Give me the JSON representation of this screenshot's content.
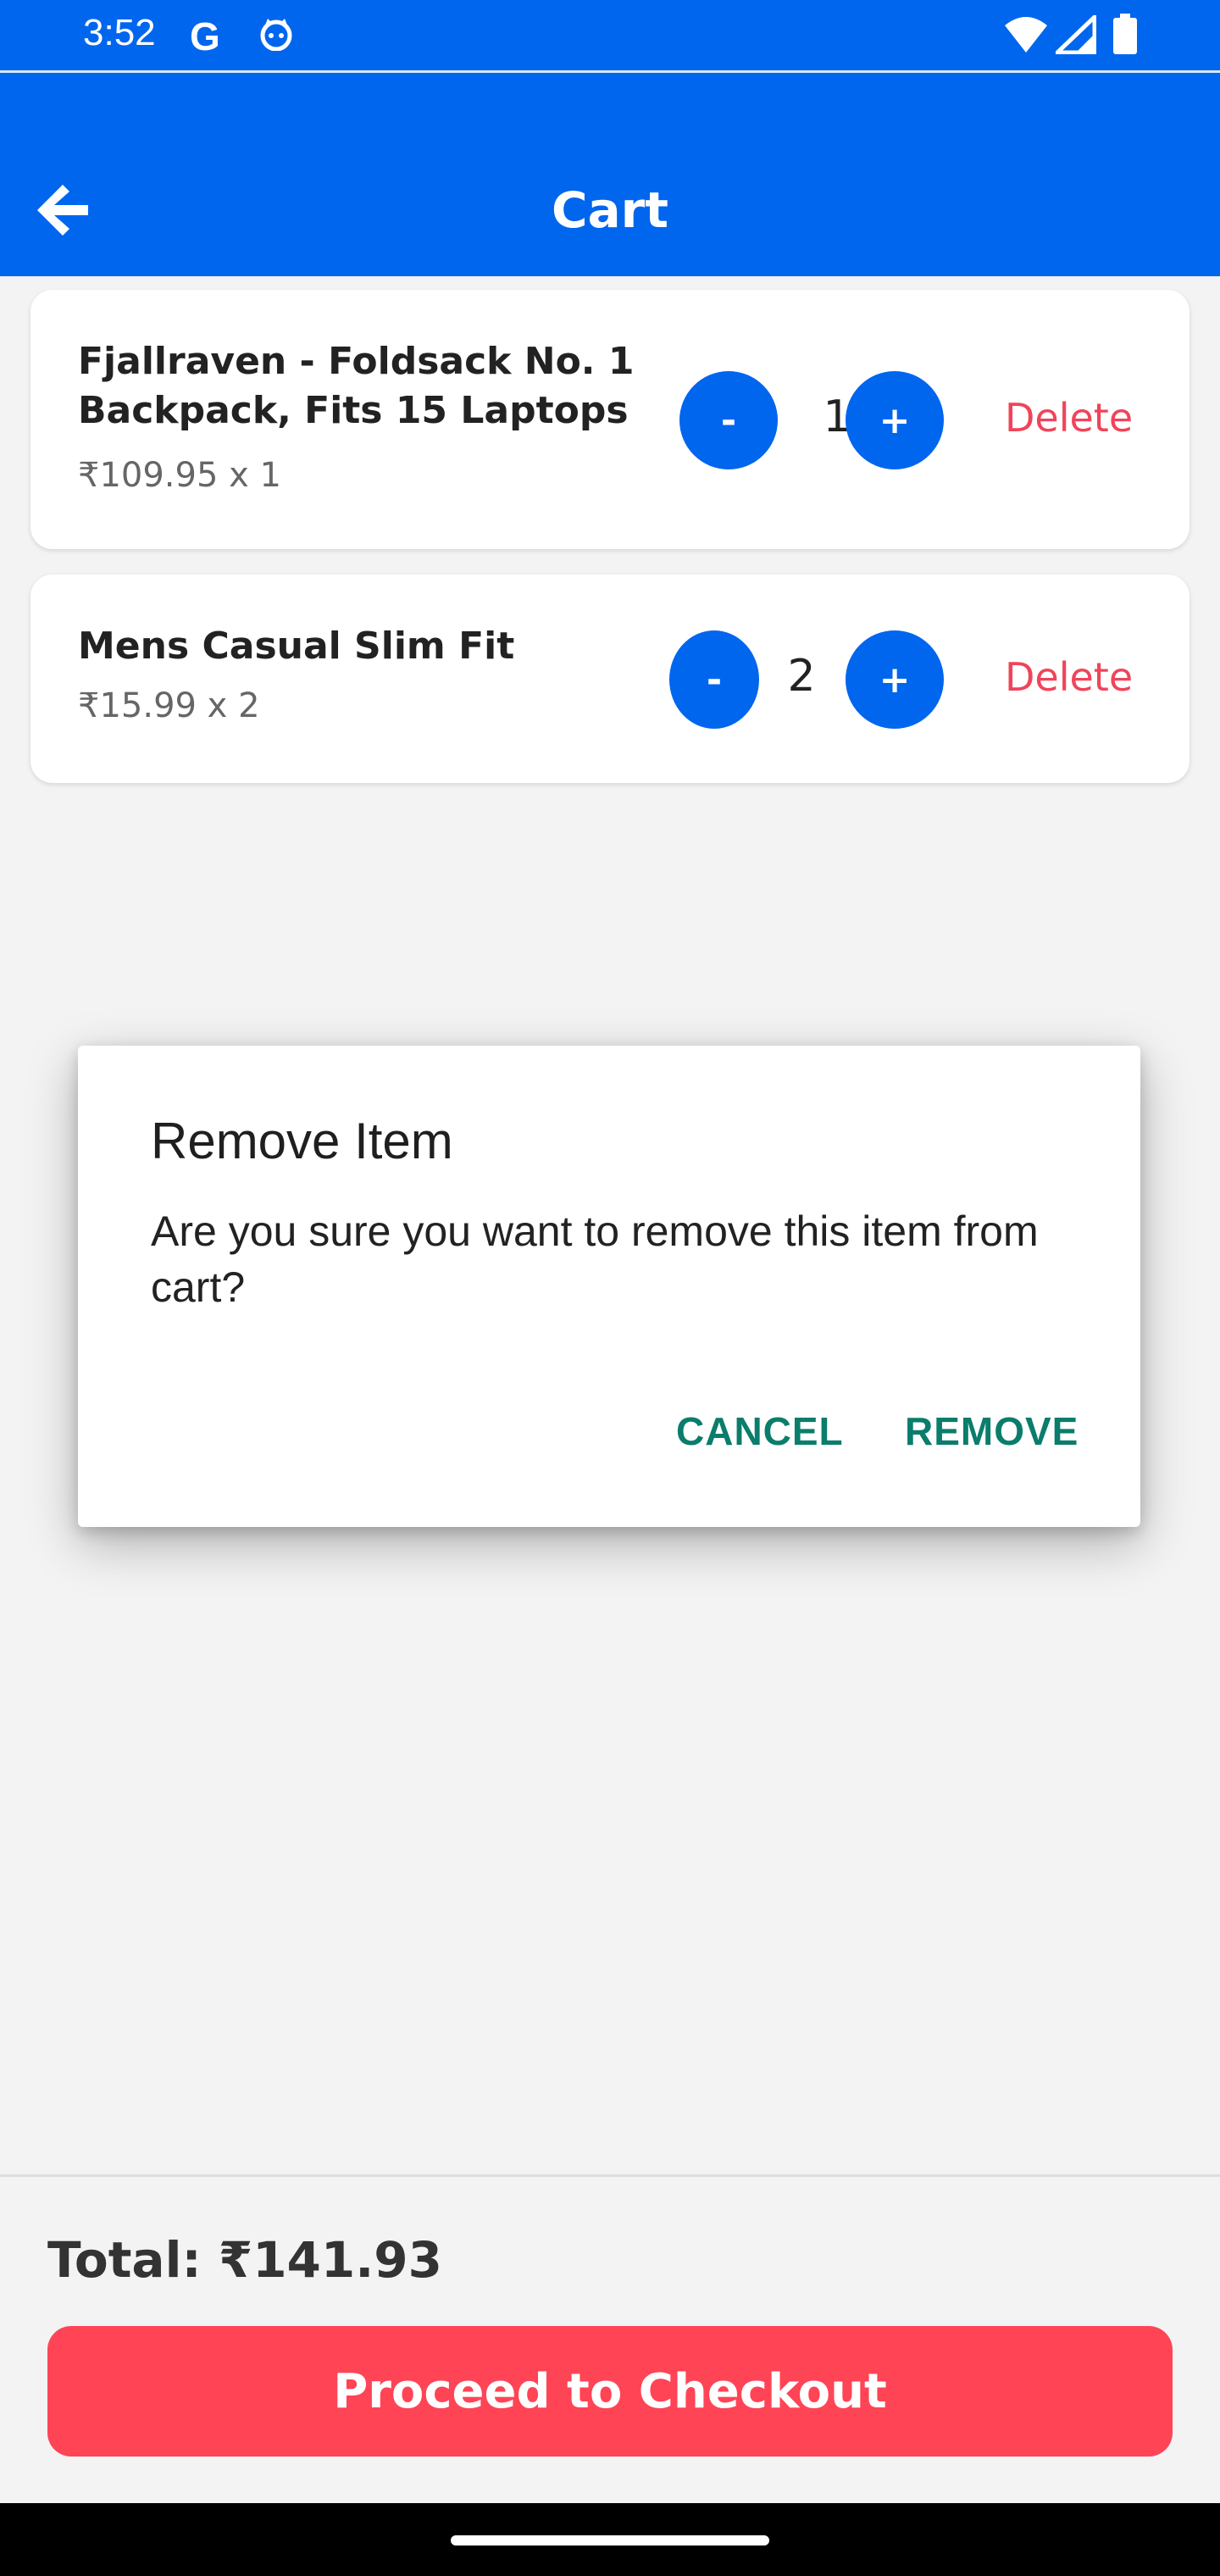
{
  "status_bar": {
    "time": "3:52",
    "google_icon": "G",
    "icons": [
      "google-icon",
      "cat-face-icon",
      "wifi-icon",
      "signal-icon",
      "battery-icon"
    ]
  },
  "app_bar": {
    "title": "Cart",
    "back_icon": "back-arrow-icon"
  },
  "cart": {
    "items": [
      {
        "name": "Fjallraven - Foldsack No. 1 Backpack, Fits 15 Laptops",
        "price_line": "₹109.95 x 1",
        "quantity": "1",
        "minus_label": "-",
        "plus_label": "+",
        "delete_label": "Delete"
      },
      {
        "name": "Mens Casual Slim Fit",
        "price_line": "₹15.99 x 2",
        "quantity": "2",
        "minus_label": "-",
        "plus_label": "+",
        "delete_label": "Delete"
      }
    ]
  },
  "dialog": {
    "title": "Remove Item",
    "message": "Are you sure you want to remove this item from cart?",
    "cancel_label": "CANCEL",
    "remove_label": "REMOVE"
  },
  "footer": {
    "total_text": "Total: ₹141.93",
    "checkout_label": "Proceed to Checkout"
  },
  "colors": {
    "primary": "#0066ee",
    "danger": "#ff4456",
    "delete_text": "#f0445a",
    "dialog_action": "#0a7d6c"
  }
}
